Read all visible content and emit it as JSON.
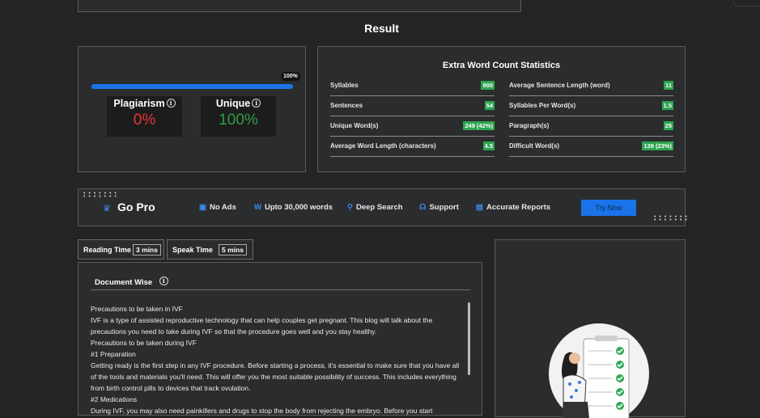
{
  "result_title": "Result",
  "plagiarism": {
    "progress_label": "100%",
    "progress_fraction": 1.0,
    "plagiarism_label": "Plagiarism",
    "plagiarism_value": "0%",
    "unique_label": "Unique",
    "unique_value": "100%",
    "info_glyph": "i",
    "colors": {
      "plagiarism": "#e53935",
      "unique": "#2e9e44",
      "bar": "#1a73e8"
    }
  },
  "stats": {
    "title": "Extra Word Count Statistics",
    "left": [
      {
        "label": "Syllables",
        "value": "900"
      },
      {
        "label": "Sentences",
        "value": "54"
      },
      {
        "label": "Unique Word(s)",
        "value": "249 (42%)"
      },
      {
        "label": "Average Word Length (characters)",
        "value": "4.5"
      }
    ],
    "right": [
      {
        "label": "Average Sentence Length (word)",
        "value": "11"
      },
      {
        "label": "Syllables Per Word(s)",
        "value": "1.5"
      },
      {
        "label": "Paragraph(s)",
        "value": "25"
      },
      {
        "label": "Difficult Word(s)",
        "value": "139 (23%)"
      }
    ],
    "badge_color": "#2ea44f"
  },
  "gopro": {
    "dots_top": "• • • • • • •\n• • • • • • •",
    "dots_bottom": "• • • • • • •\n• • • • • • •",
    "crown_icon": "♛",
    "title": "Go Pro",
    "features": [
      {
        "icon": "image-icon",
        "glyph": "▣",
        "label": "No Ads"
      },
      {
        "icon": "w-icon",
        "glyph": "W",
        "label": "Upto 30,000 words"
      },
      {
        "icon": "search-icon",
        "glyph": "⚲",
        "label": "Deep Search"
      },
      {
        "icon": "headset-icon",
        "glyph": "☊",
        "label": "Support"
      },
      {
        "icon": "report-icon",
        "glyph": "▤",
        "label": "Accurate Reports"
      }
    ],
    "cta": "Try Now"
  },
  "reading": {
    "label": "Reading Time",
    "value": "3 mins"
  },
  "speak": {
    "label": "Speak Time",
    "value": "5 mins"
  },
  "document": {
    "title": "Document Wise",
    "lines": [
      "Precautions to be taken in IVF",
      "IVF is a type of assisted reproductive technology that can help couples get pregnant. This blog will talk about the precautions you need to take during IVF so that the procedure goes well and you stay healthy.",
      "Precautions to be taken during IVF",
      "#1 Preparation",
      "Getting ready is the first step in any IVF procedure. Before starting a process, it's essential to make sure that you have all of the tools and materials you'll need. This will offer you the most suitable possibility of success. This includes everything from birth control pills to devices that track ovulation.",
      "#2 Medications",
      "During IVF, you may also need painkillers and drugs to stop the body from rejecting the embryo. Before you start"
    ]
  }
}
